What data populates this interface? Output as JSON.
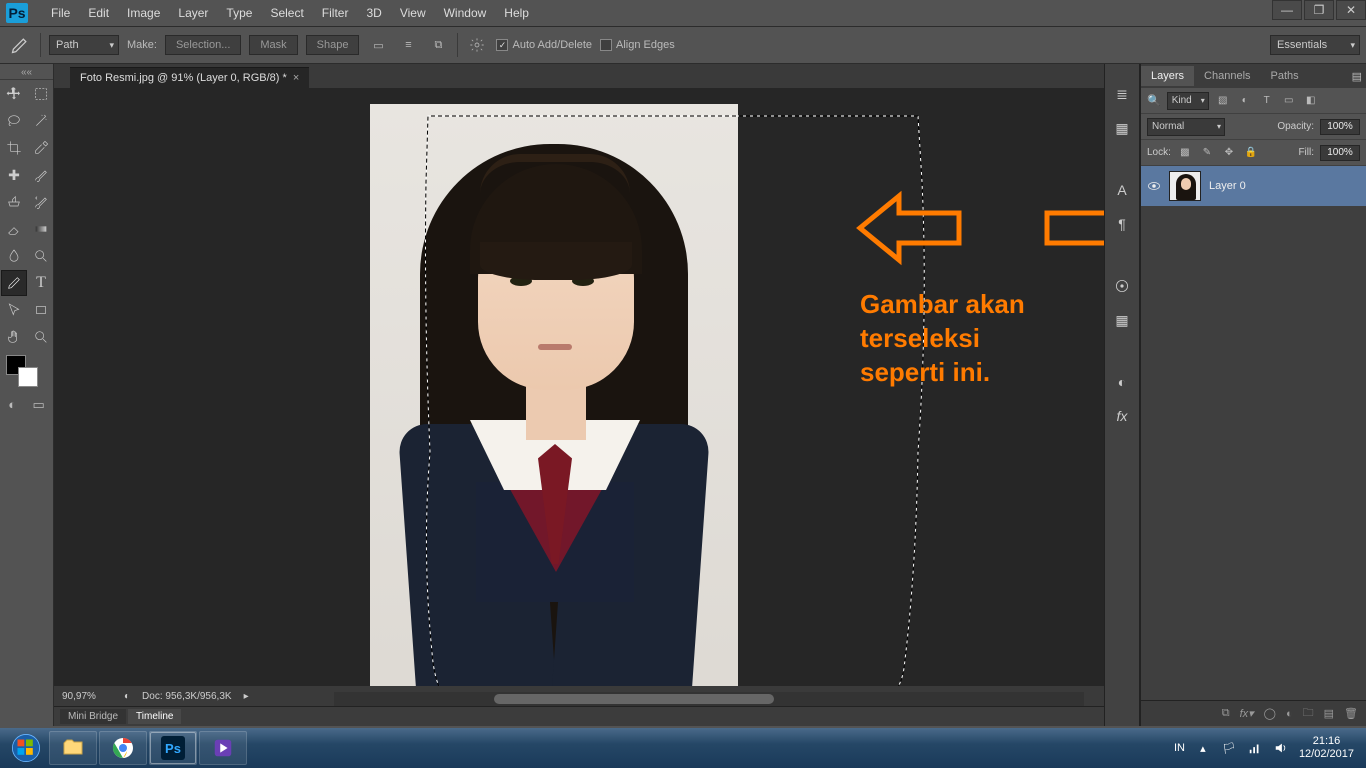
{
  "menus": [
    "File",
    "Edit",
    "Image",
    "Layer",
    "Type",
    "Select",
    "Filter",
    "3D",
    "View",
    "Window",
    "Help"
  ],
  "options": {
    "mode_label": "Path",
    "make_label": "Make:",
    "selection_btn": "Selection...",
    "mask_btn": "Mask",
    "shape_btn": "Shape",
    "auto_add_delete": "Auto Add/Delete",
    "align_edges": "Align Edges",
    "workspace": "Essentials"
  },
  "doc": {
    "tab_title": "Foto Resmi.jpg @ 91% (Layer 0, RGB/8) *",
    "zoom": "90,97%",
    "doc_info": "Doc: 956,3K/956,3K"
  },
  "annotation": {
    "line1": "Gambar akan",
    "line2": "terseleksi",
    "line3": "seperti ini."
  },
  "bottom_tabs": {
    "mini": "Mini Bridge",
    "timeline": "Timeline"
  },
  "layers": {
    "tabs": [
      "Layers",
      "Channels",
      "Paths"
    ],
    "kind_label": "Kind",
    "blend_mode": "Normal",
    "opacity_label": "Opacity:",
    "opacity_value": "100%",
    "lock_label": "Lock:",
    "fill_label": "Fill:",
    "fill_value": "100%",
    "layer_name": "Layer 0"
  },
  "taskbar": {
    "lang": "IN",
    "time": "21:16",
    "date": "12/02/2017"
  }
}
